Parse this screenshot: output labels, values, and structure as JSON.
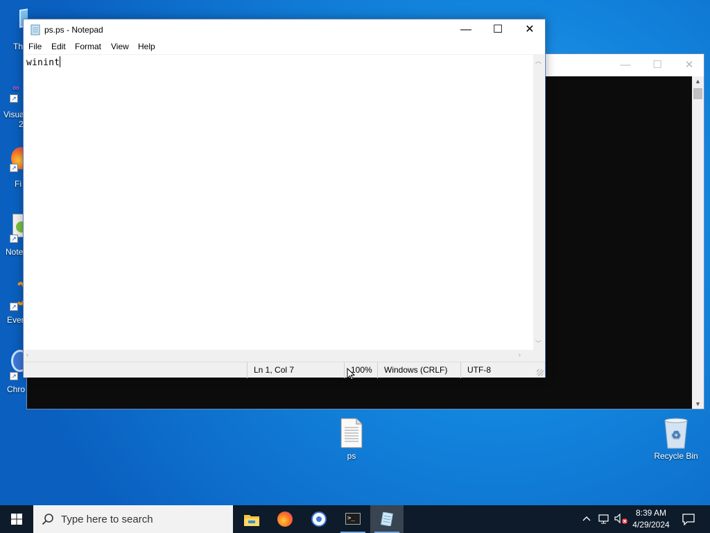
{
  "desktop": {
    "left_icons": [
      {
        "label": "Th",
        "icon": "this-pc-icon"
      },
      {
        "label": "Visua",
        "label2": "2",
        "icon": "visual-studio-icon"
      },
      {
        "label": "Fi",
        "icon": "firefox-icon"
      },
      {
        "label": "Note",
        "icon": "notepad-plus-plus-icon"
      },
      {
        "label": "Ever",
        "icon": "everything-icon"
      },
      {
        "label": "Chro",
        "icon": "chrome-icon"
      }
    ],
    "file_icon": {
      "label": "ps",
      "icon": "text-file-icon"
    },
    "recycle_bin": {
      "label": "Recycle Bin",
      "icon": "recycle-bin-icon"
    }
  },
  "console_window": {
    "minimize": "—",
    "maximize": "☐",
    "close": "✕"
  },
  "notepad": {
    "title": "ps.ps - Notepad",
    "menu": [
      "File",
      "Edit",
      "Format",
      "View",
      "Help"
    ],
    "content": "winint",
    "status": {
      "position": "Ln 1, Col 7",
      "zoom": "100%",
      "line_ending": "Windows (CRLF)",
      "encoding": "UTF-8"
    },
    "buttons": {
      "minimize": "—",
      "maximize": "☐",
      "close": "✕"
    }
  },
  "taskbar": {
    "search_placeholder": "Type here to search",
    "apps": [
      "file-explorer-icon",
      "firefox-icon",
      "chrome-icon",
      "terminal-icon",
      "notepad-icon"
    ],
    "time": "8:39 AM",
    "date": "4/29/2024"
  },
  "colors": {
    "desktop": "#1283dc",
    "taskbar": "#0d1b2a",
    "console_body": "#0c0c0c"
  }
}
